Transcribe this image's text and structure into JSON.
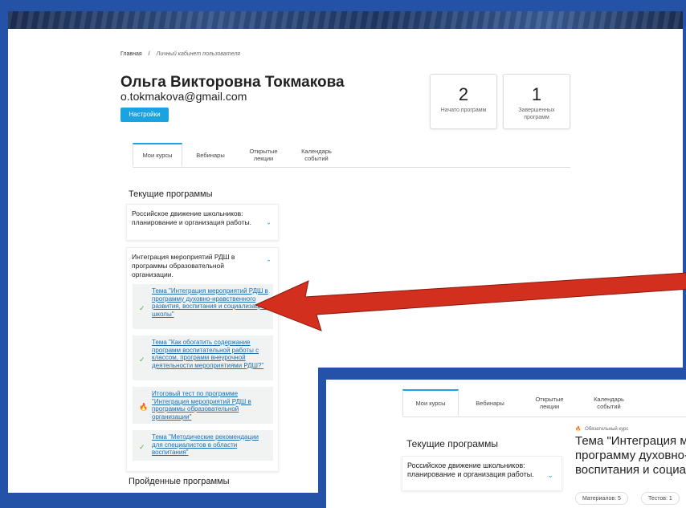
{
  "breadcrumb": {
    "home": "Главная",
    "sep": "/",
    "current": "Личный кабинет пользователя"
  },
  "profile": {
    "name": "Ольга Викторовна Токмакова",
    "email": "o.tokmakova@gmail.com",
    "settings_label": "Настройки"
  },
  "stats": [
    {
      "value": "2",
      "label": "Начато программ"
    },
    {
      "value": "1",
      "label": "Завершенных программ"
    }
  ],
  "tabs": [
    "Мои курсы",
    "Вебинары",
    "Открытые лекции",
    "Календарь событий"
  ],
  "current_programs_title": "Текущие программы",
  "courses": [
    {
      "title": "Российское движение школьников: планирование и организация работы.",
      "chevron": "⌄"
    },
    {
      "title": "Интеграция мероприятий РДШ в программы образовательной организации.",
      "chevron": "⌃"
    }
  ],
  "topics": [
    {
      "text": "Тема \"Интеграция мероприятий РДШ в программу духовно-нравственного развития, воспитания и социализации школы\"",
      "mark": "✓"
    },
    {
      "text": "Тема \"Как обогатить содержание программ воспитательной работы с классом, программ внеурочной деятельности мероприятиями РДШ?\"",
      "mark": "✓"
    },
    {
      "text": "Итоговый тест по программе \"Интеграция мероприятий РДШ в программы образовательной организации\"",
      "mark": "🔥"
    },
    {
      "text": "Тема \"Методические рекомендации для специалистов в области воспитания\"",
      "mark": "✓"
    }
  ],
  "completed_programs_title": "Пройденные программы",
  "inset": {
    "tabs": [
      "Мои курсы",
      "Вебинары",
      "Открытые лекции",
      "Календарь событий"
    ],
    "section": "Текущие программы",
    "course": "Российское движение школьников: планирование и организация работы.",
    "course_type": "Обязательный курс",
    "course_title_lines": [
      "Тема \"Интеграция ме",
      "программу духовно-н",
      "воспитания и социал"
    ],
    "chips": [
      "Материалов: 5",
      "Тестов: 1"
    ]
  },
  "colors": {
    "accent": "#1ba2e0",
    "frame": "#2352a6",
    "arrow": "#d32f1f"
  }
}
